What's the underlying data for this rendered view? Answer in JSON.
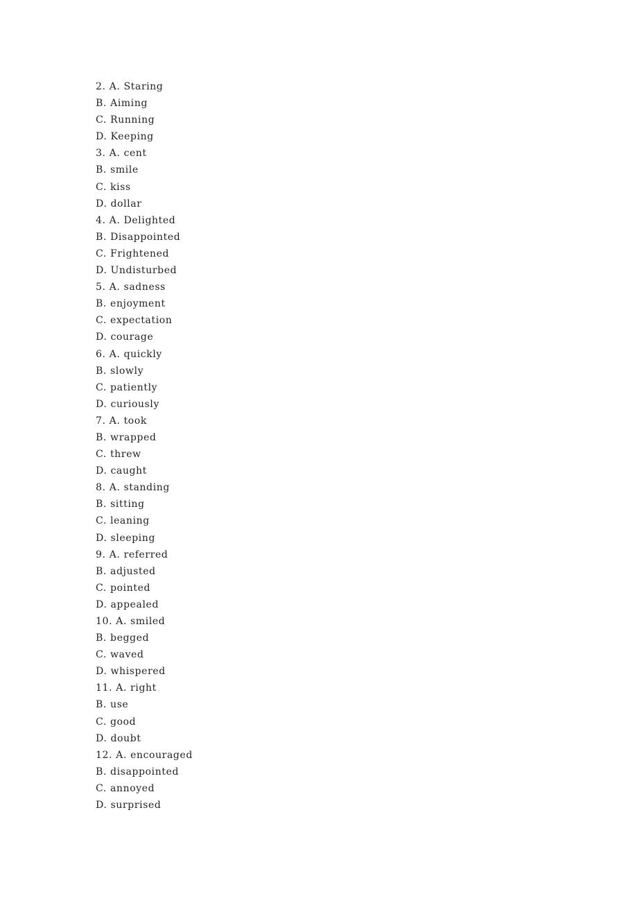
{
  "questions": [
    {
      "number": "2.",
      "options": [
        {
          "letter": "A.",
          "text": "Staring"
        },
        {
          "letter": "B.",
          "text": "Aiming"
        },
        {
          "letter": "C.",
          "text": "Running"
        },
        {
          "letter": "D.",
          "text": "Keeping"
        }
      ]
    },
    {
      "number": "3.",
      "options": [
        {
          "letter": "A.",
          "text": "cent"
        },
        {
          "letter": "B.",
          "text": "smile"
        },
        {
          "letter": "C.",
          "text": "kiss"
        },
        {
          "letter": "D.",
          "text": "dollar"
        }
      ]
    },
    {
      "number": "4.",
      "options": [
        {
          "letter": "A.",
          "text": "Delighted"
        },
        {
          "letter": "B.",
          "text": "Disappointed"
        },
        {
          "letter": "C.",
          "text": "Frightened"
        },
        {
          "letter": "D.",
          "text": "Undisturbed"
        }
      ]
    },
    {
      "number": "5.",
      "options": [
        {
          "letter": "A.",
          "text": "sadness"
        },
        {
          "letter": "B.",
          "text": "enjoyment"
        },
        {
          "letter": "C.",
          "text": "expectation"
        },
        {
          "letter": "D.",
          "text": "courage"
        }
      ]
    },
    {
      "number": "6.",
      "options": [
        {
          "letter": "A.",
          "text": "quickly"
        },
        {
          "letter": "B.",
          "text": "slowly"
        },
        {
          "letter": "C.",
          "text": "patiently"
        },
        {
          "letter": "D.",
          "text": "curiously"
        }
      ]
    },
    {
      "number": "7.",
      "options": [
        {
          "letter": "A.",
          "text": "took"
        },
        {
          "letter": "B.",
          "text": "wrapped"
        },
        {
          "letter": "C.",
          "text": "threw"
        },
        {
          "letter": "D.",
          "text": "caught"
        }
      ]
    },
    {
      "number": "8.",
      "options": [
        {
          "letter": "A.",
          "text": "standing"
        },
        {
          "letter": "B.",
          "text": "sitting"
        },
        {
          "letter": "C.",
          "text": "leaning"
        },
        {
          "letter": "D.",
          "text": "sleeping"
        }
      ]
    },
    {
      "number": "9.",
      "options": [
        {
          "letter": "A.",
          "text": "referred"
        },
        {
          "letter": "B.",
          "text": "adjusted"
        },
        {
          "letter": "C.",
          "text": "pointed"
        },
        {
          "letter": "D.",
          "text": "appealed"
        }
      ]
    },
    {
      "number": "10.",
      "options": [
        {
          "letter": "A.",
          "text": "smiled"
        },
        {
          "letter": "B.",
          "text": "begged"
        },
        {
          "letter": "C.",
          "text": "waved"
        },
        {
          "letter": "D.",
          "text": "whispered"
        }
      ]
    },
    {
      "number": "11.",
      "options": [
        {
          "letter": "A.",
          "text": "right"
        },
        {
          "letter": "B.",
          "text": "use"
        },
        {
          "letter": "C.",
          "text": "good"
        },
        {
          "letter": "D.",
          "text": "doubt"
        }
      ]
    },
    {
      "number": "12.",
      "options": [
        {
          "letter": "A.",
          "text": "encouraged"
        },
        {
          "letter": "B.",
          "text": "disappointed"
        },
        {
          "letter": "C.",
          "text": "annoyed"
        },
        {
          "letter": "D.",
          "text": "surprised"
        }
      ]
    }
  ]
}
